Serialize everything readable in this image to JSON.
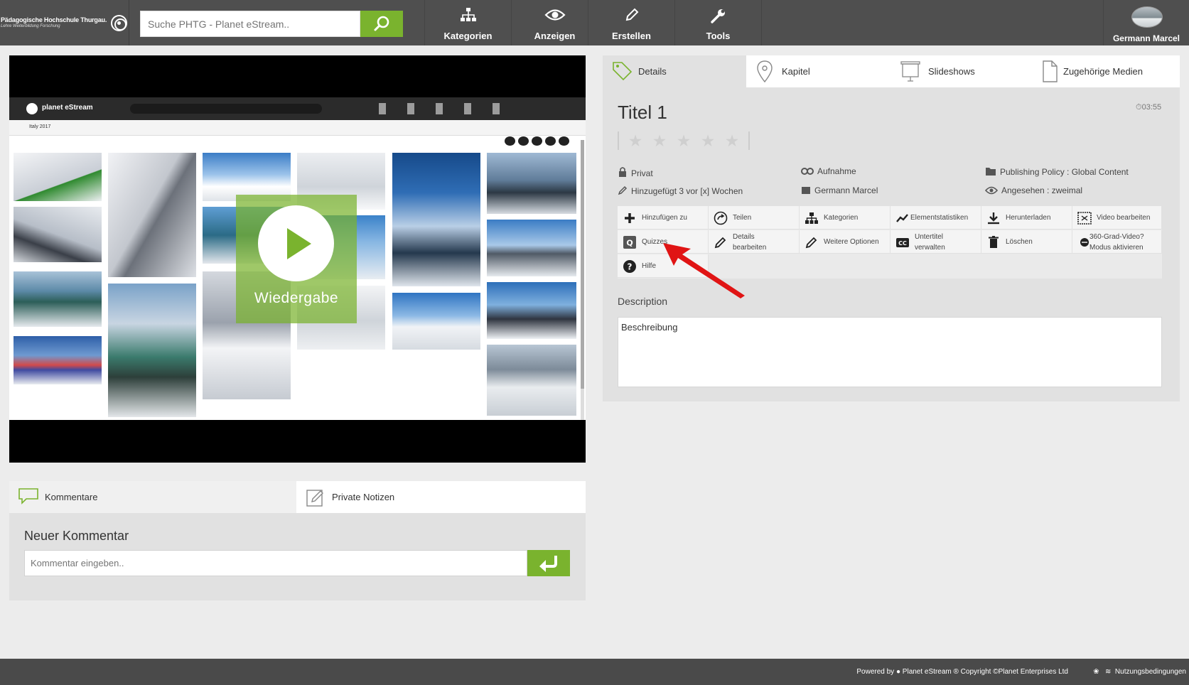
{
  "header": {
    "logo_title": "Pädagogische Hochschule Thurgau.",
    "logo_subtitle": "Lehre Weiterbildung Forschung",
    "search_placeholder": "Suche PHTG - Planet eStream..",
    "nav": [
      {
        "label": "Kategorien",
        "icon": "sitemap-icon"
      },
      {
        "label": "Anzeigen",
        "icon": "eye-icon"
      },
      {
        "label": "Erstellen",
        "icon": "pencil-icon"
      },
      {
        "label": "Tools",
        "icon": "wrench-icon"
      }
    ],
    "user_name": "Germann Marcel"
  },
  "video": {
    "play_label": "Wiedergabe",
    "embedded_app_name": "planet eStream",
    "embedded_album": "Italy 2017"
  },
  "comments": {
    "tabs": [
      "Kommentare",
      "Private Notizen"
    ],
    "new_comment_title": "Neuer Kommentar",
    "input_placeholder": "Kommentar eingeben.."
  },
  "details": {
    "tabs": [
      "Details",
      "Kapitel",
      "Slideshows",
      "Zugehörige Medien"
    ],
    "title": "Titel 1",
    "duration": "03:55",
    "rating_max": 5,
    "meta": {
      "privacy": "Privat",
      "added": "Hinzugefügt 3 vor [x] Wochen",
      "type": "Aufnahme",
      "owner": "Germann Marcel",
      "policy": "Publishing Policy : Global Content",
      "views": "Angesehen : zweimal"
    },
    "actions": [
      [
        "Hinzufügen zu"
      ],
      [
        "Teilen"
      ],
      [
        "Kategorien"
      ],
      [
        "Elementstatistiken"
      ],
      [
        "Herunterladen"
      ],
      [
        "Video bearbeiten"
      ],
      [
        "Quizzes"
      ],
      [
        "Details",
        "bearbeiten"
      ],
      [
        "Weitere Optionen"
      ],
      [
        "Untertitel",
        "verwalten"
      ],
      [
        "Löschen"
      ],
      [
        "360-Grad-Video?",
        "Modus aktivieren"
      ],
      [
        "Hilfe"
      ]
    ],
    "description_label": "Description",
    "description_text": "Beschreibung"
  },
  "footer": {
    "powered_by": "Powered by",
    "brand": "Planet eStream",
    "copyright": "® Copyright ©Planet Enterprises Ltd",
    "terms": "Nutzungsbedingungen"
  },
  "colors": {
    "accent": "#7ab32e",
    "topbar": "#4f4f4f",
    "panel": "#e1e1e1",
    "annotation_arrow": "#e01414"
  }
}
